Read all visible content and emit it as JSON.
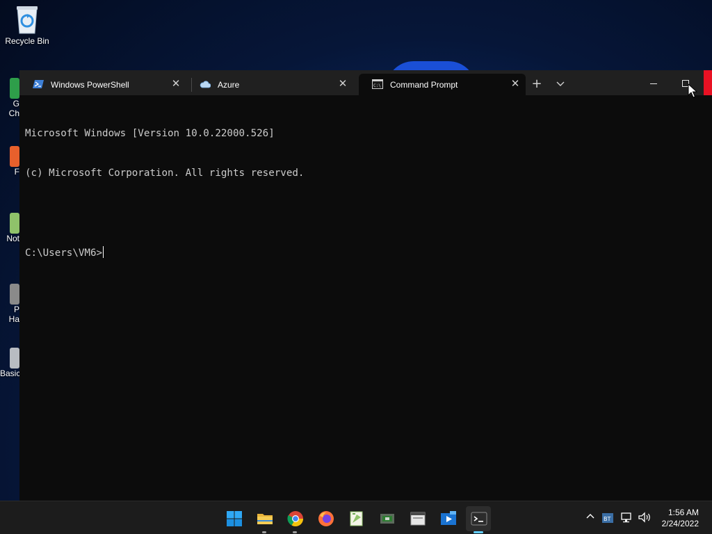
{
  "desktop": {
    "icons": [
      {
        "label": "Recycle Bin"
      }
    ],
    "partial_icons": [
      {
        "label_lines": [
          "G",
          "Ch"
        ]
      },
      {
        "label_lines": [
          "F"
        ]
      },
      {
        "label_lines": [
          "Not"
        ]
      },
      {
        "label_lines": [
          "P",
          "Ha"
        ]
      },
      {
        "label_lines": [
          "Basic"
        ]
      }
    ]
  },
  "terminal": {
    "tabs": [
      {
        "label": "Windows PowerShell",
        "icon": "powershell-icon"
      },
      {
        "label": "Azure",
        "icon": "azure-cloud-icon"
      },
      {
        "label": "Command Prompt",
        "icon": "cmd-icon",
        "active": true
      }
    ],
    "buttons": {
      "new_tab": "+",
      "dropdown": "⌄",
      "minimize": "—",
      "maximize": "☐"
    },
    "console_lines": [
      "Microsoft Windows [Version 10.0.22000.526]",
      "(c) Microsoft Corporation. All rights reserved.",
      "",
      "C:\\Users\\VM6>"
    ]
  },
  "taskbar": {
    "apps": [
      {
        "name": "start",
        "icon": "windows-logo-icon"
      },
      {
        "name": "file-explorer",
        "icon": "folder-icon"
      },
      {
        "name": "chrome",
        "icon": "chrome-icon"
      },
      {
        "name": "firefox",
        "icon": "firefox-icon"
      },
      {
        "name": "notepad-plus",
        "icon": "notepad-icon"
      },
      {
        "name": "hardware-tool",
        "icon": "chip-icon"
      },
      {
        "name": "app-window",
        "icon": "window-app-icon"
      },
      {
        "name": "media-player",
        "icon": "media-player-icon"
      },
      {
        "name": "terminal",
        "icon": "terminal-icon",
        "active": true
      }
    ],
    "tray": {
      "chevron": "^",
      "clock_time": "1:56 AM",
      "clock_date": "2/24/2022"
    }
  },
  "colors": {
    "terminal_bg": "#0c0c0c",
    "titlebar_bg": "#202020",
    "taskbar_bg": "#1c1c1c",
    "accent": "#60cdff",
    "close_red": "#e81123"
  }
}
